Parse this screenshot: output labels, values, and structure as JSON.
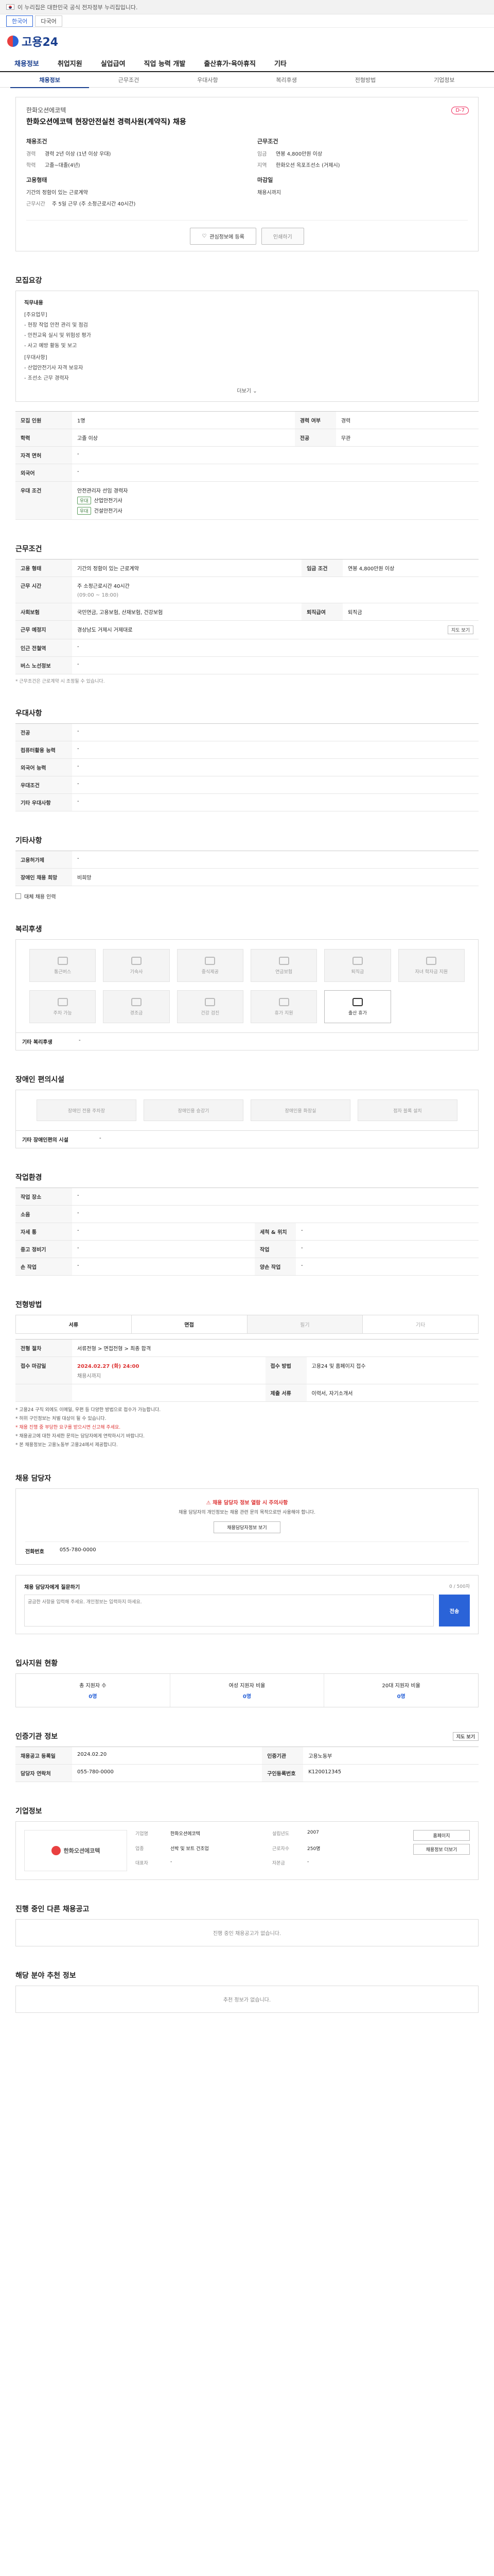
{
  "gov": {
    "text": "이 누리집은 대한민국 공식 전자정부 누리집입니다."
  },
  "lang": {
    "korean": "한국어",
    "other": "다국어"
  },
  "brand": {
    "name": "고용24"
  },
  "gnb": [
    "채용정보",
    "취업지원",
    "실업급여",
    "직업 능력 개발",
    "출산휴가·육아휴직",
    "기타"
  ],
  "subnav": [
    "채용정보",
    "근무조건",
    "우대사항",
    "복리후생",
    "전형방법",
    "기업정보"
  ],
  "job": {
    "company": "한화오션에코텍",
    "title": "한화오션에코텍 현장안전실천 경력사원(계약직) 채용",
    "badge": "D-7",
    "left_head": "채용조건",
    "right_head": "근무조건",
    "edu_k": "경력",
    "edu_v": "경력 2년 이상 (1년 이상 우대)",
    "career_k": "학력",
    "career_v": "고졸~대졸(4년)",
    "type_k": "고용형태",
    "type_v": "기간의 정함이 있는 근로계약",
    "period_k": "근무예정일",
    "period_v": "즉시 가능",
    "salary_k": "임금",
    "salary_v": "연봉 4,800만원 이상",
    "loc_k": "지역",
    "loc_v": "한화오션 옥포조선소 (거제시)",
    "hours_k": "근무시간",
    "hours_v": "주 5일 근무 (주 소정근로시간 40시간)",
    "deadline_k": "마감일",
    "deadline_v": "채용시까지",
    "btn_interest": "관심정보에 등록",
    "btn_print": "인쇄하기"
  },
  "detail": {
    "title": "모집요강",
    "box_label": "직무내용",
    "lines": [
      "[주요업무]",
      "- 현장 작업 안전 관리 및 점검",
      "- 안전교육 실시 및 위험성 평가",
      "- 사고 예방 활동 및 보고",
      "[우대사항]",
      "- 산업안전기사 자격 보유자",
      "- 조선소 근무 경력자"
    ],
    "more": "더보기"
  },
  "recruit_table": {
    "rows": [
      {
        "k1": "모집 인원",
        "v1": "1명",
        "k2": "경력 여부",
        "v2": "경력"
      },
      {
        "k1": "학력",
        "v1": "고졸 이상",
        "k2": "전공",
        "v2": "무관"
      },
      {
        "k1": "자격 면허",
        "v1": "-",
        "k2": "",
        "v2": ""
      },
      {
        "k1": "외국어",
        "v1": "-",
        "k2": "",
        "v2": ""
      },
      {
        "k1": "우대 조건",
        "v1": "안전관리자 선임 경력자",
        "k2": "",
        "v2": ""
      }
    ],
    "tag1": "우대",
    "tag1_text": "산업안전기사",
    "tag2": "우대",
    "tag2_text": "건설안전기사"
  },
  "work_cond": {
    "title": "근무조건",
    "salary_k": "고용 형태",
    "salary_v": "기간의 정함이 있는 근로계약",
    "pay_k": "임금 조건",
    "pay_v": "연봉 4,800만원 이상",
    "hours_k": "근무 시간",
    "hours_v": "주 소정근로시간 40시간",
    "hours_sub": "(09:00 ~ 18:00)",
    "ins_k": "사회보험",
    "ins_v": "국민연금, 고용보험, 산재보험, 건강보험",
    "retire_k": "퇴직급여",
    "retire_v": "퇴직금",
    "loc_k": "근무 예정지",
    "loc_v": "경상남도 거제시 거제대로",
    "map_btn": "지도 보기",
    "nearby_k": "인근 전철역",
    "nearby_v": "-",
    "bus_k": "버스 노선정보",
    "bus_v": "-",
    "note": "* 근무조건은 근로계약 시 조정될 수 있습니다."
  },
  "prefer": {
    "title": "우대사항",
    "rows": [
      {
        "k": "전공",
        "v": "-"
      },
      {
        "k": "컴퓨터활용 능력",
        "v": "-"
      },
      {
        "k": "외국어 능력",
        "v": "-"
      },
      {
        "k": "우대조건",
        "v": "-"
      },
      {
        "k": "기타 우대사항",
        "v": "-"
      }
    ]
  },
  "etc": {
    "title": "기타사항",
    "rows": [
      {
        "k": "고용허가제",
        "v": "-"
      },
      {
        "k": "장애인 채용 희망",
        "v": "비희망"
      }
    ],
    "checkbox": "대체 채용 인력"
  },
  "welfare": {
    "title": "복리후생",
    "items": [
      "통근버스",
      "기숙사",
      "중식제공",
      "연금보험",
      "퇴직금",
      "자녀 학자금 지원",
      "주차 가능",
      "경조금",
      "건강 검진",
      "휴가 지원",
      "출산 휴가"
    ],
    "on_label": "출산 휴가",
    "etc_k": "기타 복리후생",
    "etc_v": "-"
  },
  "disabled": {
    "title": "장애인 편의시설",
    "items": [
      "장애인 전용 주차장",
      "장애인용 승강기",
      "장애인용 화장실",
      "점자 블록 설치"
    ],
    "etc_k": "기타 장애인편의 시설",
    "etc_v": "-"
  },
  "process": {
    "title": "작업환경",
    "rows": [
      {
        "k1": "작업 장소",
        "v1": "-",
        "k2": "",
        "v2": ""
      },
      {
        "k1": "소음",
        "v1": "-",
        "k2": "",
        "v2": ""
      },
      {
        "k1": "자세 통",
        "v1": "-",
        "k2": "세척 & 위치",
        "v2": "-"
      },
      {
        "k1": "중고 정비기",
        "v1": "-",
        "k2": "작업",
        "v2": "-"
      },
      {
        "k1": "손 작업",
        "v1": "-",
        "k2": "양손 작업",
        "v2": "-"
      }
    ]
  },
  "screening": {
    "title": "전형방법",
    "methods": [
      "서류",
      "면접",
      "필기",
      "기타"
    ],
    "steps_k": "전형 절차",
    "steps_v": "서류전형 > 면접전형 > 최종 합격",
    "period_k": "접수 마감일",
    "period_v": "2024.02.27 (화) 24:00",
    "period_sub": "채용시까지",
    "method_k": "접수 방법",
    "method_v": "고용24 및 홈페이지 접수",
    "docs_k": "제출 서류",
    "docs_v": "이력서, 자기소개서"
  },
  "notices": [
    "* 고용24 구직 외에도 이메일, 우편 등 다양한 방법으로 접수가 가능합니다.",
    "* 허위 구인정보는 처벌 대상이 될 수 있습니다.",
    "* 채용 진행 중 부당한 요구를 받으시면 신고해 주세요.",
    "* 채용공고에 대한 자세한 문의는 담당자에게 연락하시기 바랍니다.",
    "* 본 채용정보는 고용노동부 고용24에서 제공합니다."
  ],
  "contact": {
    "title": "채용 담당자",
    "warn": "채용 담당자 정보 열람 시 주의사항",
    "warn_text": "채용 담당자의 개인정보는 채용 관련 문의 목적으로만 사용해야 합니다.",
    "btn": "채용담당자정보 보기",
    "phone_k": "전화번호",
    "phone_v": "055-780-0000"
  },
  "inquiry": {
    "title": "채용 담당자에게 질문하기",
    "limit": "0 / 500자",
    "placeholder": "궁금한 사항을 입력해 주세요. 개인정보는 입력하지 마세요.",
    "send": "전송"
  },
  "applicants": {
    "title": "입사지원 현황",
    "items": [
      {
        "k": "총 지원자 수",
        "v": "0명"
      },
      {
        "k": "여성 지원자 비율",
        "v": "0명"
      },
      {
        "k": "20대 지원자 비율",
        "v": "0명"
      }
    ]
  },
  "agency": {
    "title": "인증기관 정보",
    "rows": [
      {
        "k1": "채용공고 등록일",
        "v1": "2024.02.20",
        "k2": "인증기관",
        "v2": "고용노동부"
      },
      {
        "k1": "담당자 연락처",
        "v1": "055-780-0000",
        "k2": "구인등록번호",
        "v2": "K120012345"
      }
    ],
    "btn": "지도 보기"
  },
  "company": {
    "title": "기업정보",
    "name": "한화오션에코텍",
    "fields": [
      {
        "k": "기업명",
        "v": "한화오션에코텍"
      },
      {
        "k": "업종",
        "v": "선박 및 보트 건조업"
      },
      {
        "k": "대표자",
        "v": "-"
      },
      {
        "k": "설립년도",
        "v": "2007"
      },
      {
        "k": "근로자수",
        "v": "250명"
      },
      {
        "k": "자본금",
        "v": "-"
      }
    ],
    "btn1": "홈페이지",
    "btn2": "채용정보 더보기"
  },
  "other_jobs": {
    "title": "진행 중인 다른 채용공고",
    "empty": "진행 중인 채용공고가 없습니다."
  },
  "similar": {
    "title": "해당 분야 추천 정보",
    "empty": "추천 정보가 없습니다."
  }
}
